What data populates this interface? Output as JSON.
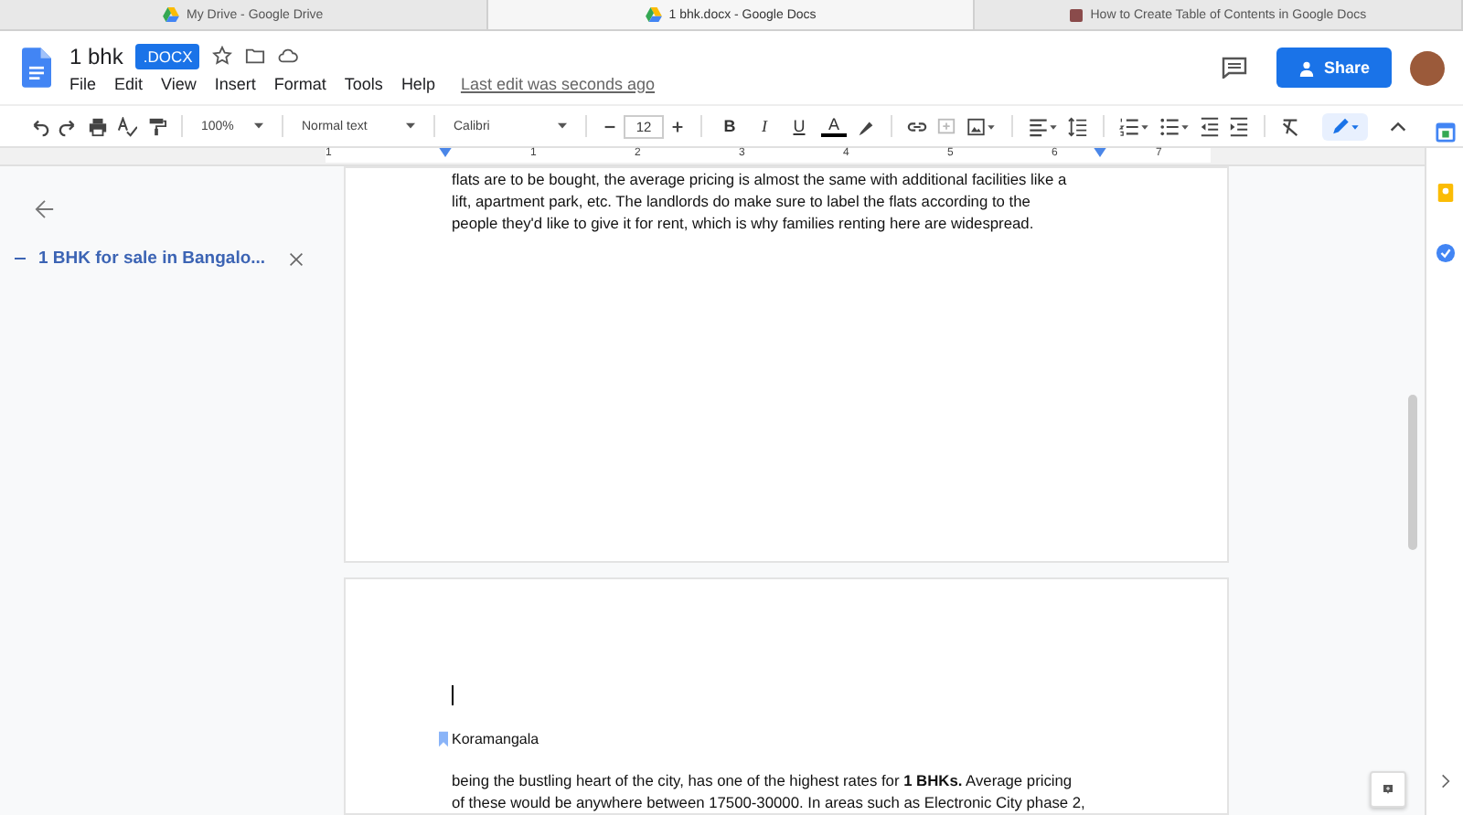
{
  "browser_tabs": [
    {
      "title": "My Drive - Google Drive",
      "kind": "drive",
      "selected": false
    },
    {
      "title": "1 bhk.docx - Google Docs",
      "kind": "drive",
      "selected": true
    },
    {
      "title": "How to Create Table of Contents in Google Docs",
      "kind": "site",
      "selected": false
    }
  ],
  "document": {
    "title": "1 bhk",
    "badge": ".DOCX",
    "last_edit": "Last edit was seconds ago"
  },
  "menu": [
    "File",
    "Edit",
    "View",
    "Insert",
    "Format",
    "Tools",
    "Help"
  ],
  "share_button": "Share",
  "toolbar": {
    "zoom": "100%",
    "style": "Normal text",
    "font": "Calibri",
    "font_size": "12",
    "bold": "B",
    "italic": "I",
    "underline": "U",
    "text_color": "A"
  },
  "ruler": [
    "1",
    "1",
    "2",
    "3",
    "4",
    "5",
    "6",
    "7"
  ],
  "outline": {
    "items": [
      {
        "text": "1 BHK for sale in Bangalo...",
        "selected": true
      }
    ]
  },
  "page1_lines": [
    "flats are to be bought, the average pricing is almost the same with additional facilities like a",
    "lift, apartment park, etc. The landlords do make sure to label the flats according to the",
    "people they'd like to give it for rent, which is why families renting here are widespread."
  ],
  "page2": {
    "heading": "Koramangala",
    "lines": [
      "being the bustling heart of the city, has one of the highest rates for **1 BHKs.** Average pricing",
      "of these would be anywhere between 17500-30000. In areas such as Electronic City phase 2,"
    ]
  }
}
